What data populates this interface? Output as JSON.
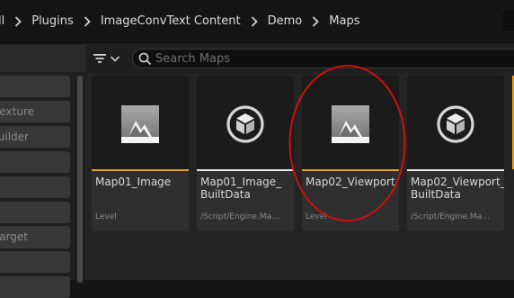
{
  "breadcrumb": {
    "items": [
      "ll",
      "Plugins",
      "ImageConvText Content",
      "Demo",
      "Maps"
    ]
  },
  "left_panel": {
    "items": [
      "",
      "exture",
      "uilder",
      "",
      "",
      "",
      "",
      "arget",
      "",
      ""
    ]
  },
  "toolbar": {
    "search_placeholder": "Search Maps"
  },
  "assets": [
    {
      "name": "Map01_Image",
      "type": "Level",
      "icon": "level-icon",
      "accent": "#e0a020"
    },
    {
      "name": "Map01_Image_\nBuiltData",
      "type": "/Script/Engine.Ma...",
      "icon": "cube-icon",
      "accent": "#e8e8e8"
    },
    {
      "name": "Map02_Viewport",
      "type": "Level",
      "icon": "level-icon",
      "accent": "#e0a020"
    },
    {
      "name": "Map02_Viewport_\nBuiltData",
      "type": "/Script/Engine.Ma...",
      "icon": "cube-icon",
      "accent": "#e8e8e8"
    }
  ],
  "annotation": {
    "shape": "ellipse",
    "color": "#cc1111"
  }
}
